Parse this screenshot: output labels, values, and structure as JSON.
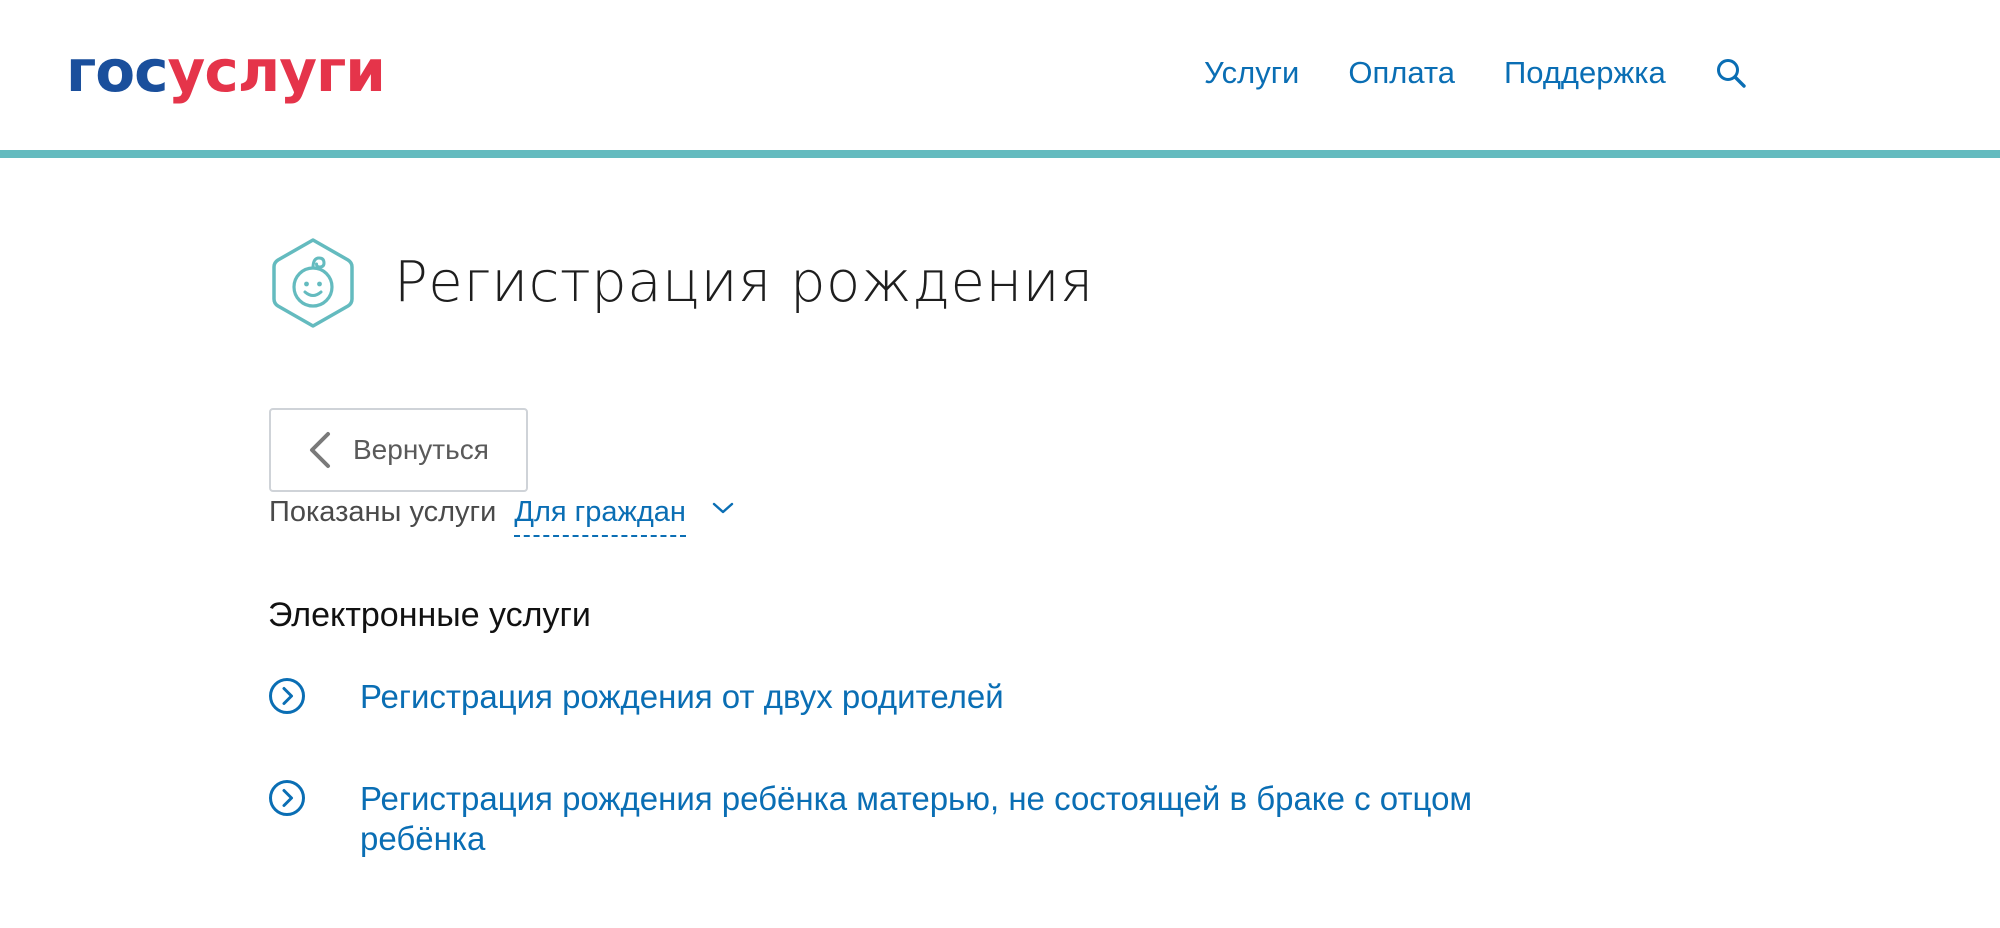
{
  "header": {
    "logo_part_a": "гос",
    "logo_part_b": "услуги",
    "nav": [
      "Услуги",
      "Оплата",
      "Поддержка"
    ],
    "search_icon": "search-icon",
    "stripe_color": "#64bbbf"
  },
  "page": {
    "title": "Регистрация рождения",
    "title_icon": "baby-face-icon"
  },
  "back_button": {
    "label": "Вернуться",
    "icon": "chevron-left-icon"
  },
  "filter": {
    "prefix": "Показаны услуги",
    "selected": "Для граждан",
    "icon": "chevron-down-icon"
  },
  "section": {
    "title": "Электронные услуги",
    "items": [
      {
        "label": "Регистрация рождения от двух родителей",
        "icon": "circle-arrow-right-icon"
      },
      {
        "label": "Регистрация рождения ребёнка матерью, не состоящей в браке с отцом ребёнка",
        "icon": "circle-arrow-right-icon"
      }
    ]
  },
  "colors": {
    "link": "#0a6eb4",
    "logo_blue": "#1a4f9c",
    "logo_red": "#e5344a",
    "accent_teal": "#64bbbf"
  }
}
